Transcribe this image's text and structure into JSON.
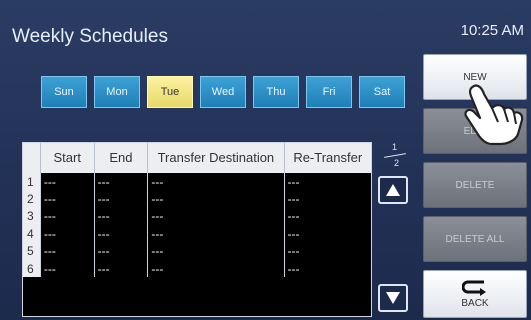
{
  "header": {
    "title": "Weekly Schedules",
    "time": "10:25 AM"
  },
  "days": {
    "sun": "Sun",
    "mon": "Mon",
    "tue": "Tue",
    "wed": "Wed",
    "thu": "Thu",
    "fri": "Fri",
    "sat": "Sat",
    "selected": "Tue"
  },
  "table": {
    "headers": {
      "start": "Start",
      "end": "End",
      "dest": "Transfer Destination",
      "retransfer": "Re-Transfer"
    },
    "rows": [
      {
        "num": "1",
        "start": "---",
        "end": "---",
        "dest": "---",
        "retransfer": "---"
      },
      {
        "num": "2",
        "start": "---",
        "end": "---",
        "dest": "---",
        "retransfer": "---"
      },
      {
        "num": "3",
        "start": "---",
        "end": "---",
        "dest": "---",
        "retransfer": "---"
      },
      {
        "num": "4",
        "start": "---",
        "end": "---",
        "dest": "---",
        "retransfer": "---"
      },
      {
        "num": "5",
        "start": "---",
        "end": "---",
        "dest": "---",
        "retransfer": "---"
      },
      {
        "num": "6",
        "start": "---",
        "end": "---",
        "dest": "---",
        "retransfer": "---"
      }
    ]
  },
  "pagination": {
    "current": "1",
    "total": "2"
  },
  "buttons": {
    "new": "NEW",
    "edit": "EDIT",
    "delete": "DELETE",
    "delete_all": "DELETE ALL",
    "back": "BACK"
  },
  "icons": {
    "scroll_up": "triangle-up-icon",
    "scroll_down": "triangle-down-icon",
    "back": "back-arrow-icon",
    "pointer": "pointing-hand-icon"
  },
  "colors": {
    "day_button": "#2a8cc6",
    "day_selected": "#f2e58a",
    "background": "#24355a"
  }
}
